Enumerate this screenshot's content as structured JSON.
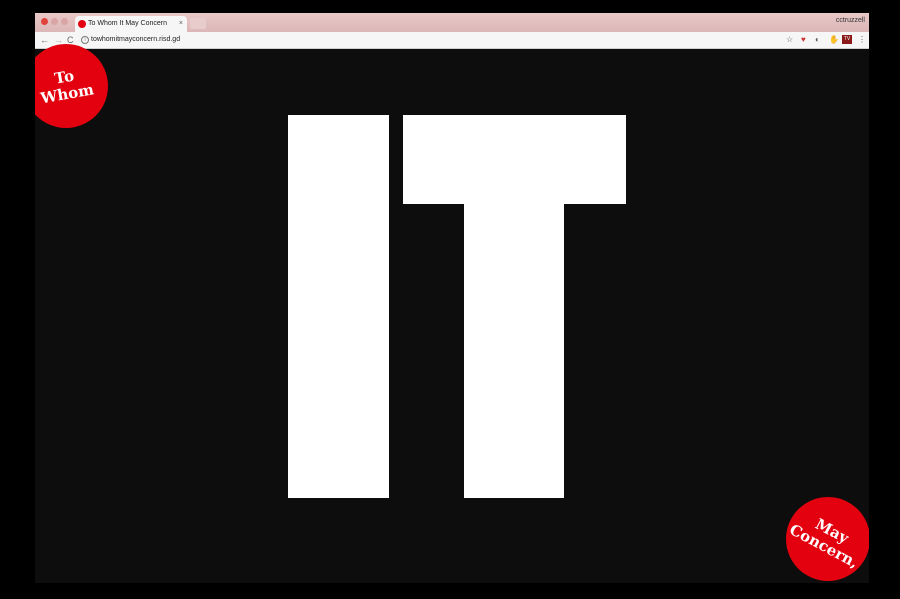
{
  "browser": {
    "tab": {
      "title": "To Whom It May Concern",
      "close_glyph": "×"
    },
    "profile_name": "cctruzzell",
    "address_bar": {
      "url": "towhomitmayconcern.risd.gd",
      "info_glyph": "i"
    },
    "nav": {
      "back_glyph": "←",
      "forward_glyph": "→",
      "reload_glyph": "C"
    },
    "extensions": {
      "star_glyph": "☆",
      "pocket_glyph": "♥",
      "moon_glyph": "◐",
      "hand_glyph": "✋",
      "tv_label": "TV",
      "menu_glyph": "⋮"
    }
  },
  "page": {
    "badge_top": {
      "line1": "To",
      "line2": "Whom"
    },
    "badge_bottom": {
      "line1": "May",
      "line2": "Concern,"
    },
    "hero_text": "IT",
    "accent_color": "#e3000f",
    "background_color": "#0d0d0d"
  }
}
